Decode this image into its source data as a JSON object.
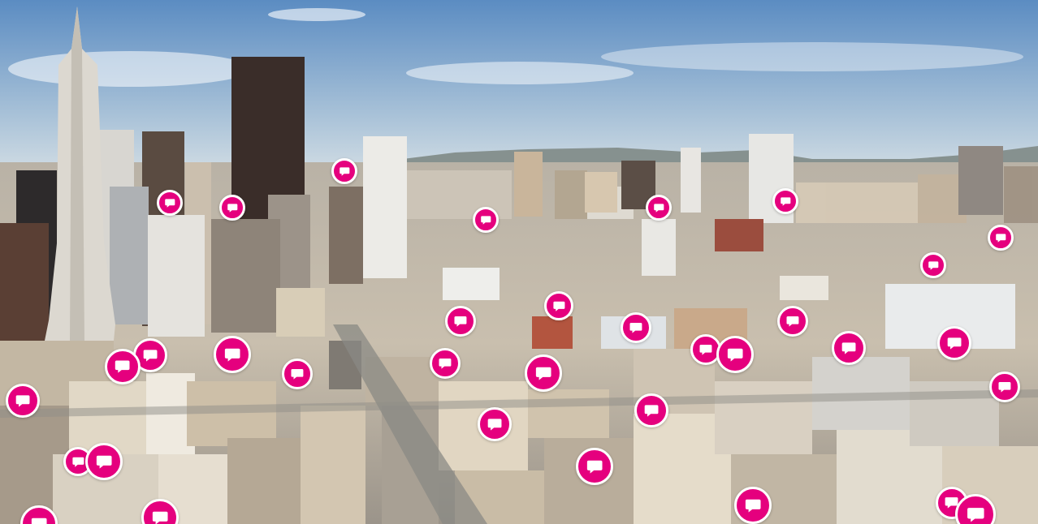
{
  "scene": {
    "description_icon": "city-skyline-photo",
    "colors": {
      "sky_top": "#5f8fc3",
      "sky_bottom": "#e9ecec",
      "hills": "#7f8a89",
      "buildings_light": "#e6e1d8",
      "buildings_mid": "#c6b8a4",
      "buildings_dark": "#3f3430",
      "street": "#8a8a84"
    }
  },
  "markers": {
    "icon": "speech-bubble-icon",
    "fill_color": "#e5007e",
    "border_color": "#ffffff",
    "count": 36
  }
}
